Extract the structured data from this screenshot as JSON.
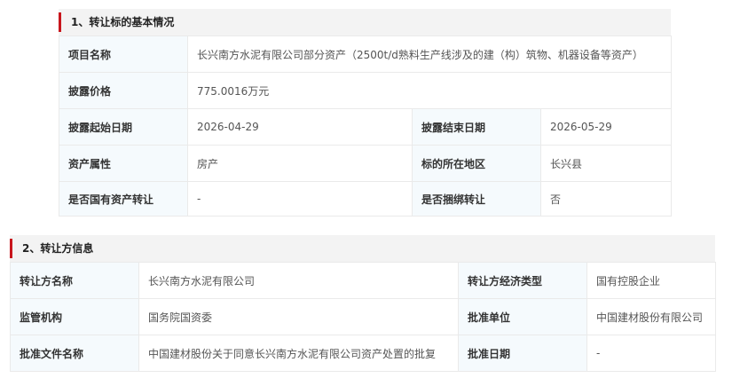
{
  "section1": {
    "title": "1、转让标的基本情况",
    "project_name_label": "项目名称",
    "project_name_value": "长兴南方水泥有限公司部分资产（2500t/d熟料生产线涉及的建（构）筑物、机器设备等资产）",
    "price_label": "披露价格",
    "price_value": "775.0016万元",
    "start_date_label": "披露起始日期",
    "start_date_value": "2026-04-29",
    "end_date_label": "披露结束日期",
    "end_date_value": "2026-05-29",
    "asset_type_label": "资产属性",
    "asset_type_value": "房产",
    "location_label": "标的所在地区",
    "location_value": "长兴县",
    "state_owned_label": "是否国有资产转让",
    "state_owned_value": "-",
    "bundled_label": "是否捆绑转让",
    "bundled_value": "否"
  },
  "section2": {
    "title": "2、转让方信息",
    "transferor_label": "转让方名称",
    "transferor_value": "长兴南方水泥有限公司",
    "econ_type_label": "转让方经济类型",
    "econ_type_value": "国有控股企业",
    "regulator_label": "监管机构",
    "regulator_value": "国务院国资委",
    "approver_label": "批准单位",
    "approver_value": "中国建材股份有限公司",
    "approval_doc_label": "批准文件名称",
    "approval_doc_value": "中国建材股份关于同意长兴南方水泥有限公司资产处置的批复",
    "approval_date_label": "批准日期",
    "approval_date_value": "-"
  },
  "colors": {
    "accent": "#c8161d",
    "header_bg": "#f3f3f3",
    "label_bg": "#f5fafd",
    "border": "#eaeaea"
  }
}
